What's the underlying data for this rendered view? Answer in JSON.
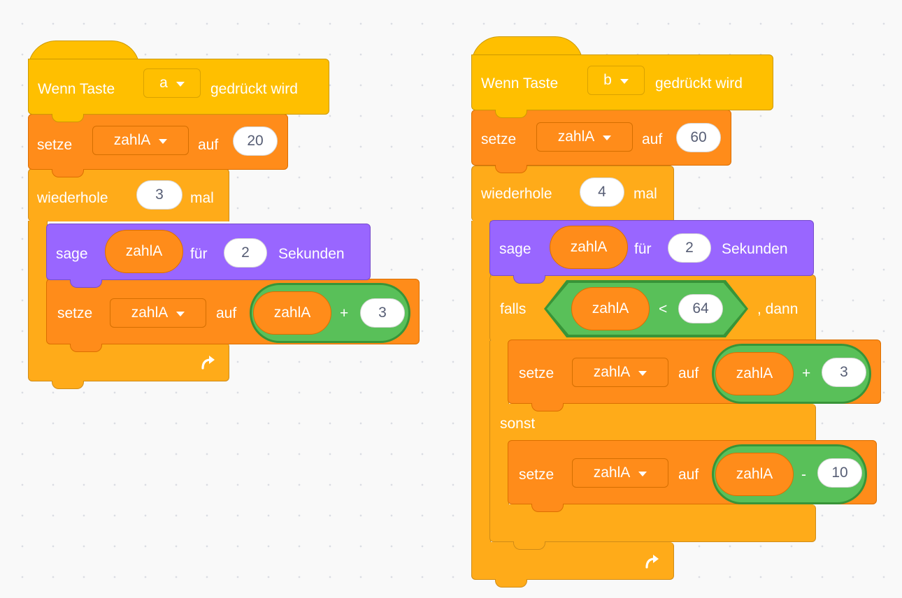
{
  "colors": {
    "events": "#ffbf00",
    "variables": "#ff8c1a",
    "control": "#ffab19",
    "looks": "#9966ff",
    "operators": "#59c059",
    "background": "#f9f9f9"
  },
  "script_a": {
    "hat": {
      "label_before": "Wenn Taste",
      "key": "a",
      "label_after": "gedrückt wird"
    },
    "set": {
      "label": "setze",
      "variable": "zahlA",
      "label_to": "auf",
      "value": "20"
    },
    "repeat": {
      "label": "wiederhole",
      "count": "3",
      "label_times": "mal",
      "loop_icon": "loop-arrow-icon",
      "say": {
        "label": "sage",
        "reporter": "zahlA",
        "label_for": "für",
        "seconds": "2",
        "label_seconds": "Sekunden"
      },
      "set": {
        "label": "setze",
        "variable": "zahlA",
        "label_to": "auf",
        "op_left": "zahlA",
        "operator": "+",
        "op_right": "3"
      }
    }
  },
  "script_b": {
    "hat": {
      "label_before": "Wenn Taste",
      "key": "b",
      "label_after": "gedrückt wird"
    },
    "set": {
      "label": "setze",
      "variable": "zahlA",
      "label_to": "auf",
      "value": "60"
    },
    "repeat": {
      "label": "wiederhole",
      "count": "4",
      "label_times": "mal",
      "loop_icon": "loop-arrow-icon",
      "say": {
        "label": "sage",
        "reporter": "zahlA",
        "label_for": "für",
        "seconds": "2",
        "label_seconds": "Sekunden"
      },
      "if_else": {
        "label_if": "falls",
        "cond_left": "zahlA",
        "cond_op": "<",
        "cond_right": "64",
        "label_then": ", dann",
        "set_then": {
          "label": "setze",
          "variable": "zahlA",
          "label_to": "auf",
          "op_left": "zahlA",
          "operator": "+",
          "op_right": "3"
        },
        "label_else": "sonst",
        "set_else": {
          "label": "setze",
          "variable": "zahlA",
          "label_to": "auf",
          "op_left": "zahlA",
          "operator": "-",
          "op_right": "10"
        }
      }
    }
  }
}
